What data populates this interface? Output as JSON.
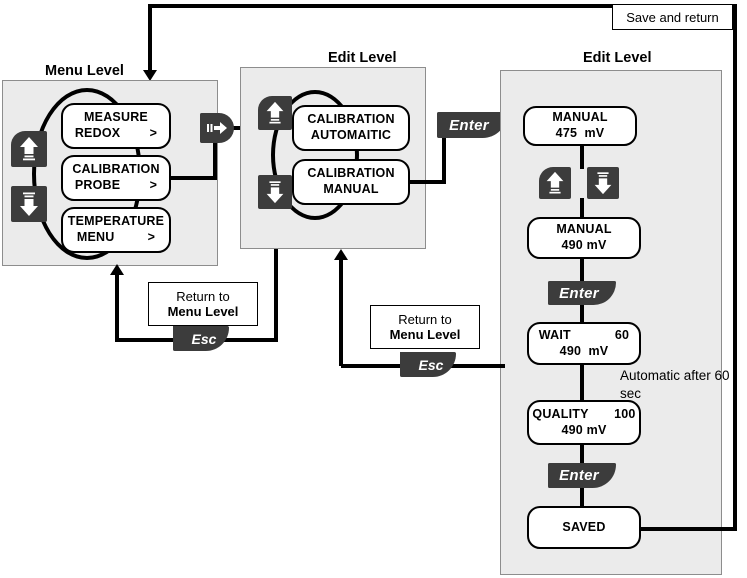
{
  "diagram": {
    "title_top_note": "Save and return",
    "panels": [
      {
        "name": "menu-level",
        "title": "Menu Level"
      },
      {
        "name": "edit-level-middle",
        "title": "Edit Level"
      },
      {
        "name": "edit-level-right",
        "title": "Edit Level"
      }
    ]
  },
  "menu_level": {
    "title": "Menu Level",
    "items": [
      {
        "line1": "MEASURE",
        "line2": "REDOX        >"
      },
      {
        "line1": "CALIBRATION",
        "line2": "PROBE        >"
      },
      {
        "line1": "TEMPERATURE",
        "line2": "MENU         >"
      }
    ],
    "keys": {
      "up": "up-arrow",
      "down": "down-arrow"
    }
  },
  "edit_level_middle": {
    "title": "Edit Level",
    "items": [
      {
        "line1": "CALIBRATION",
        "line2": "AUTOMAITIC"
      },
      {
        "line1": "CALIBRATION",
        "line2": "MANUAL"
      }
    ],
    "keys": {
      "up": "up-arrow",
      "down": "down-arrow"
    }
  },
  "edit_level_right": {
    "title": "Edit Level",
    "steps": [
      {
        "line1": "MANUAL",
        "line2": "475  mV"
      },
      {
        "line1": "MANUAL",
        "line2": "490 mV"
      },
      {
        "line1": "WAIT            60",
        "line2": "490  mV"
      },
      {
        "line1": "QUALITY       100",
        "line2": "490 mV"
      },
      {
        "line1": "SAVED",
        "line2": ""
      }
    ],
    "keys": {
      "up": "up-arrow",
      "down": "down-arrow",
      "enter": "Enter"
    },
    "annotation": "Automatic after 60 sec"
  },
  "transitions": {
    "menu_to_edit": "right-arrow-key",
    "edit_to_value": "Enter",
    "enter_label": "Enter",
    "esc_label": "Esc"
  },
  "return_notes": [
    {
      "line1": "Return to",
      "line2": "Menu Level",
      "key": "Esc"
    },
    {
      "line1": "Return to",
      "line2": "Menu Level",
      "key": "Esc"
    }
  ],
  "colors": {
    "panel_bg": "#ebebeb",
    "key_dark": "#3c3c3c",
    "line": "#000000",
    "box_bg": "#ffffff"
  }
}
